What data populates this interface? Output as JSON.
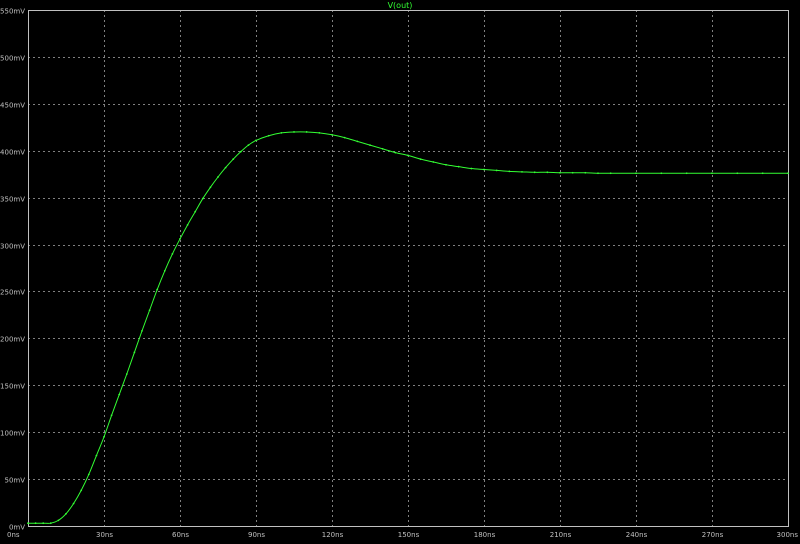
{
  "colors": {
    "background": "#000000",
    "axis": "#c0c0c0",
    "grid": "#808080",
    "label_text": "#c0c0c0",
    "trace": "#33ff33"
  },
  "chart_data": {
    "type": "line",
    "title": "V(out)",
    "xlabel": "",
    "ylabel": "",
    "x_unit": "ns",
    "y_unit": "mV",
    "xlim": [
      0,
      300
    ],
    "ylim": [
      0,
      550
    ],
    "grid": true,
    "x_ticks": [
      {
        "value": 0,
        "label": "0ns"
      },
      {
        "value": 30,
        "label": "30ns"
      },
      {
        "value": 60,
        "label": "60ns"
      },
      {
        "value": 90,
        "label": "90ns"
      },
      {
        "value": 120,
        "label": "120ns"
      },
      {
        "value": 150,
        "label": "150ns"
      },
      {
        "value": 180,
        "label": "180ns"
      },
      {
        "value": 210,
        "label": "210ns"
      },
      {
        "value": 240,
        "label": "240ns"
      },
      {
        "value": 270,
        "label": "270ns"
      },
      {
        "value": 300,
        "label": "300ns"
      }
    ],
    "y_ticks": [
      {
        "value": 0,
        "label": "0mV"
      },
      {
        "value": 50,
        "label": "50mV"
      },
      {
        "value": 100,
        "label": "100mV"
      },
      {
        "value": 150,
        "label": "150mV"
      },
      {
        "value": 200,
        "label": "200mV"
      },
      {
        "value": 250,
        "label": "250mV"
      },
      {
        "value": 300,
        "label": "300mV"
      },
      {
        "value": 350,
        "label": "350mV"
      },
      {
        "value": 400,
        "label": "400mV"
      },
      {
        "value": 450,
        "label": "450mV"
      },
      {
        "value": 500,
        "label": "500mV"
      },
      {
        "value": 550,
        "label": "550mV"
      }
    ],
    "series": [
      {
        "name": "V(out)",
        "x": [
          0,
          3,
          6,
          9,
          12,
          15,
          18,
          21,
          24,
          27,
          30,
          33,
          36,
          39,
          42,
          45,
          48,
          51,
          54,
          57,
          60,
          63,
          66,
          69,
          72,
          75,
          78,
          81,
          84,
          87,
          90,
          95,
          100,
          105,
          110,
          115,
          120,
          125,
          130,
          135,
          140,
          145,
          150,
          155,
          160,
          165,
          170,
          175,
          180,
          185,
          190,
          195,
          200,
          205,
          210,
          215,
          220,
          225,
          230,
          240,
          250,
          260,
          270,
          280,
          290,
          300
        ],
        "y": [
          3,
          3,
          3,
          3,
          6,
          13,
          24,
          38,
          55,
          75,
          95,
          118,
          140,
          162,
          185,
          208,
          230,
          252,
          272,
          290,
          306,
          321,
          335,
          349,
          361,
          372,
          382,
          391,
          399,
          406,
          411,
          416,
          419,
          420,
          420,
          419,
          417,
          414,
          410,
          406,
          402,
          398,
          395,
          391,
          388,
          385,
          383,
          381,
          380,
          379,
          378,
          377.5,
          377,
          377,
          376.5,
          376.5,
          376.5,
          376,
          376,
          376,
          376,
          376,
          376,
          376,
          376,
          376
        ]
      }
    ]
  }
}
